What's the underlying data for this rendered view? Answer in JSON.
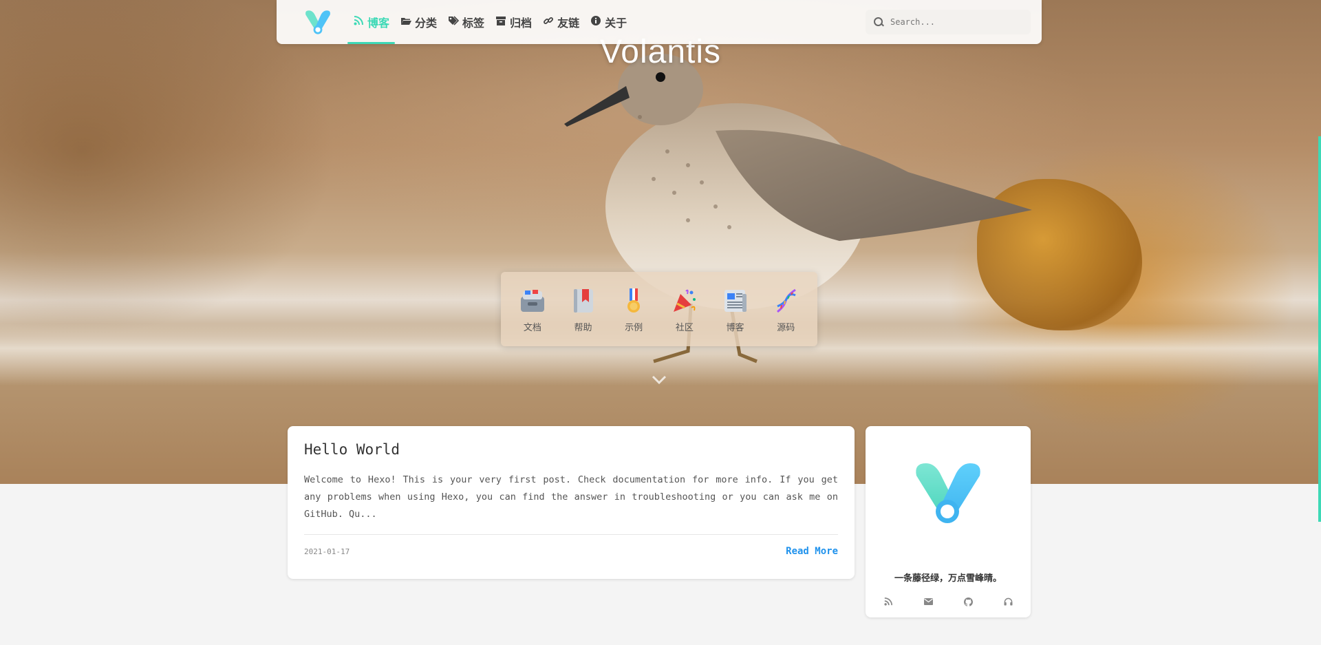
{
  "site": {
    "title": "Volantis"
  },
  "nav": {
    "items": [
      {
        "label": "博客",
        "icon": "rss-icon",
        "active": true
      },
      {
        "label": "分类",
        "icon": "folder-open-icon",
        "active": false
      },
      {
        "label": "标签",
        "icon": "tags-icon",
        "active": false
      },
      {
        "label": "归档",
        "icon": "archive-icon",
        "active": false
      },
      {
        "label": "友链",
        "icon": "link-icon",
        "active": false
      },
      {
        "label": "关于",
        "icon": "info-circle-icon",
        "active": false
      }
    ],
    "search_placeholder": "Search..."
  },
  "quick_links": [
    {
      "label": "文档",
      "icon": "file-box-emoji-icon"
    },
    {
      "label": "帮助",
      "icon": "bookmark-book-emoji-icon"
    },
    {
      "label": "示例",
      "icon": "medal-emoji-icon"
    },
    {
      "label": "社区",
      "icon": "party-popper-emoji-icon"
    },
    {
      "label": "博客",
      "icon": "newspaper-emoji-icon"
    },
    {
      "label": "源码",
      "icon": "dna-emoji-icon"
    }
  ],
  "post": {
    "title": "Hello World",
    "excerpt": "Welcome to Hexo! This is your very first post. Check documentation for more info. If you get any problems when using Hexo, you can find the answer in troubleshooting or you can ask me on GitHub. Qu...",
    "date": "2021-01-17",
    "read_more": "Read More"
  },
  "sidebar": {
    "motto": "一条藤径绿，万点雪峰晴。",
    "social": [
      "rss-icon",
      "envelope-icon",
      "github-icon",
      "headphones-icon"
    ]
  },
  "colors": {
    "accent": "#3dd9b6",
    "link": "#2092ec",
    "logo_left": "#6ee2cc",
    "logo_right": "#4fc3f7"
  }
}
